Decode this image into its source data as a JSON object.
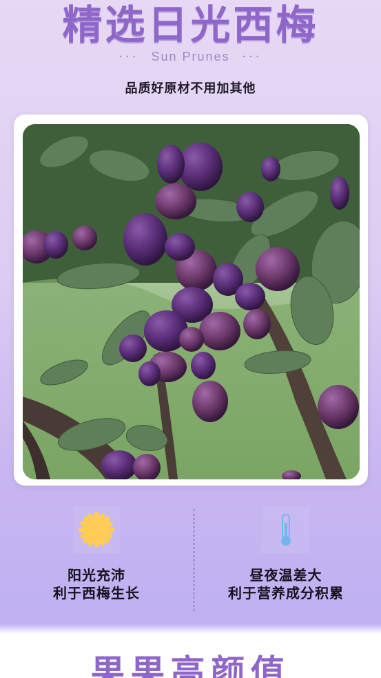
{
  "header": {
    "title": "精选日光西梅",
    "subtitle_dots_left": "···",
    "subtitle": "Sun Prunes",
    "subtitle_dots_right": "···",
    "tagline": "品质好原材不用加其他"
  },
  "photo": {
    "icon": "plum-tree-photo"
  },
  "features": [
    {
      "icon": "sun-icon",
      "line1": "阳光充沛",
      "line2": "利于西梅生长"
    },
    {
      "icon": "thermometer-icon",
      "line1": "昼夜温差大",
      "line2": "利于营养成分积累"
    }
  ],
  "footer": {
    "title": "果果高颜值"
  },
  "colors": {
    "accent": "#8f67c9",
    "sun": "#ffcc55",
    "thermo": "#6fb7ea"
  }
}
